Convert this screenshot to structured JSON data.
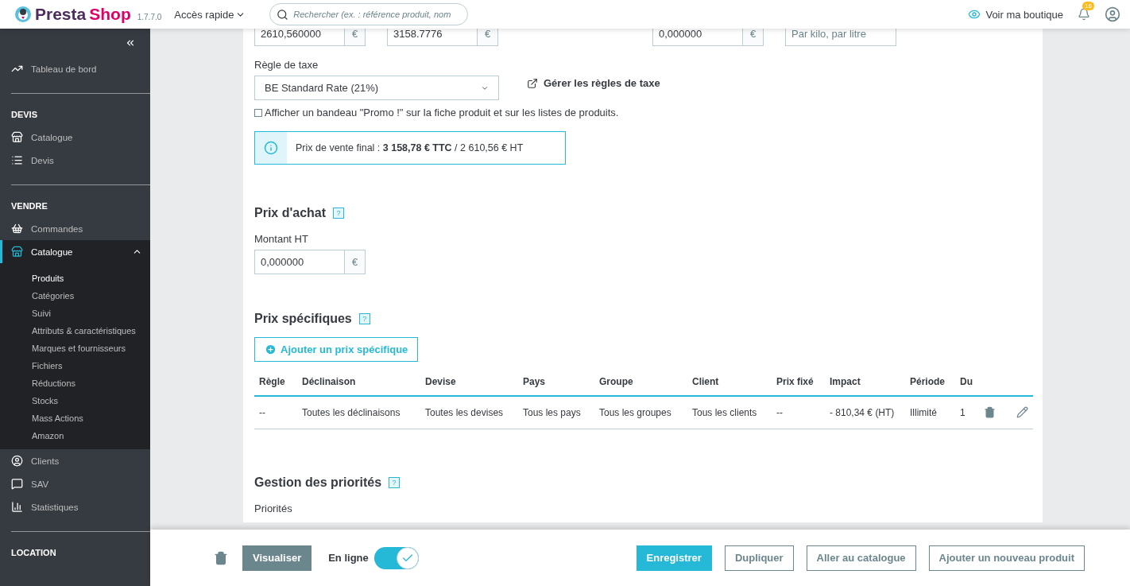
{
  "header": {
    "logo_first": "Presta",
    "logo_second": "Shop",
    "version": "1.7.7.0",
    "quick_access": "Accès rapide",
    "search": {
      "placeholder": "Rechercher (ex. : référence produit, nom"
    },
    "view_shop": "Voir ma boutique",
    "notification_count": "16"
  },
  "sidebar": {
    "top_items": [
      {
        "label": "Tableau de bord",
        "selected": false
      }
    ],
    "sections": [
      {
        "title": "DEVIS",
        "items": [
          {
            "label": "Catalogue",
            "selected": false
          },
          {
            "label": "Devis",
            "selected": false
          }
        ]
      },
      {
        "title": "VENDRE",
        "items": [
          {
            "label": "Commandes",
            "selected": false
          },
          {
            "label": "Catalogue",
            "selected": true,
            "expanded": true,
            "children": [
              {
                "label": "Produits",
                "selected": true
              },
              {
                "label": "Catégories",
                "selected": false
              },
              {
                "label": "Suivi",
                "selected": false
              },
              {
                "label": "Attributs & caractéristiques",
                "selected": false
              },
              {
                "label": "Marques et fournisseurs",
                "selected": false
              },
              {
                "label": "Fichiers",
                "selected": false
              },
              {
                "label": "Réductions",
                "selected": false
              },
              {
                "label": "Stocks",
                "selected": false
              },
              {
                "label": "Mass Actions",
                "selected": false
              },
              {
                "label": "Amazon",
                "selected": false
              }
            ]
          },
          {
            "label": "Clients",
            "selected": false
          },
          {
            "label": "SAV",
            "selected": false
          },
          {
            "label": "Statistiques",
            "selected": false
          }
        ]
      },
      {
        "title": "LOCATION"
      }
    ]
  },
  "price_fields": [
    {
      "value": "2610,560000",
      "suffix": "€"
    },
    {
      "value": "3158.7776",
      "suffix": "€"
    },
    {
      "value": "0,000000",
      "suffix": "€"
    },
    {
      "placeholder": "Par kilo, par litre"
    }
  ],
  "tax_rule": {
    "label": "Règle de taxe",
    "value": "BE Standard Rate (21%)",
    "manage_link": "Gérer les règles de taxe"
  },
  "promo_checkbox": {
    "label": "Afficher un bandeau \"Promo !\" sur la fiche produit et sur les listes de produits.",
    "checked": false
  },
  "final_price": "Prix de vente final : **3 158,78 € TTC** / 2 610,56 € HT",
  "purchase": {
    "title": "Prix d'achat",
    "help": "?",
    "label": "Montant HT",
    "value": "0,000000",
    "suffix": "€"
  },
  "specific_prices": {
    "title": "Prix spécifiques",
    "help": "?",
    "add_button": "Ajouter un prix spécifique",
    "table": {
      "columns": [
        "Règle",
        "Déclinaison",
        "Devise",
        "Pays",
        "Groupe",
        "Client",
        "Prix fixé",
        "Impact",
        "Période",
        "Du"
      ],
      "rows": [
        [
          "--",
          "Toutes les déclinaisons",
          "Toutes les devises",
          "Tous les pays",
          "Tous les groupes",
          "Tous les clients",
          "--",
          "- 810,34 € (HT)",
          "Illimité",
          "1"
        ]
      ]
    }
  },
  "priorities": {
    "title": "Gestion des priorités",
    "help": "?",
    "label": "Priorités"
  },
  "footer": {
    "preview": "Visualiser",
    "online_label": "En ligne",
    "online": true,
    "buttons": [
      {
        "label": "Enregistrer",
        "kind": "primary"
      },
      {
        "label": "Dupliquer",
        "kind": "outline"
      },
      {
        "label": "Aller au catalogue",
        "kind": "outline"
      },
      {
        "label": "Ajouter un nouveau produit",
        "kind": "outline"
      }
    ]
  }
}
